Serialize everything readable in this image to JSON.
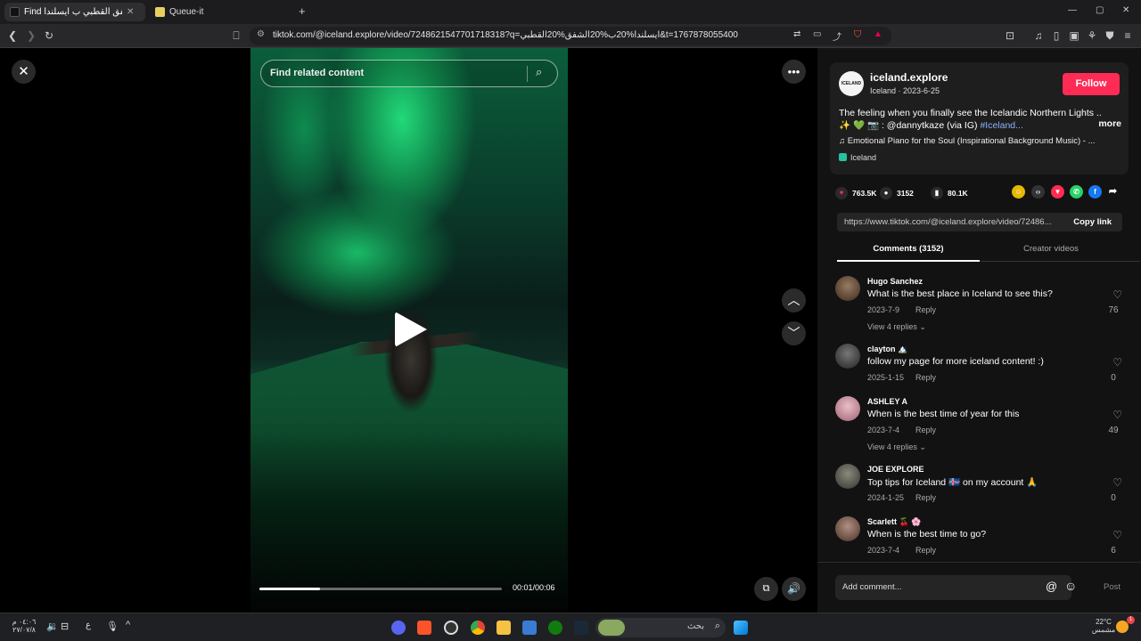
{
  "browser": {
    "tabs": [
      {
        "label": "Find الشفق القطبي ب ايسلندا"
      },
      {
        "label": "Queue-it"
      }
    ],
    "new_tab": "+",
    "url": "tiktok.com/@iceland.explore/video/7248621547701718318?q=ايسلندا%20ب%20الشفق%20القطبي&t=1767878055400",
    "window_controls": [
      "—",
      "▢",
      "✕"
    ]
  },
  "video": {
    "search_placeholder": "Find related content",
    "time": "00:01/00:06",
    "progress": 0.25
  },
  "author": {
    "avatar_text": "ICELAND",
    "username": "iceland.explore",
    "subtitle": "Iceland · 2023-6-25",
    "follow_label": "Follow",
    "description_line1": "The feeling when you finally see the Icelandic Northern Lights ..",
    "description_line2": "✨ 💚 📷 : @dannytkaze (via IG)",
    "hashtag": "#Iceland...",
    "more_label": "more",
    "music": "♫  Emotional Piano for the Soul (Inspirational Background Music) - ...",
    "location": "Iceland"
  },
  "stats": {
    "likes": "763.5K",
    "comments": "3152",
    "saves": "80.1K"
  },
  "link": {
    "url": "https://www.tiktok.com/@iceland.explore/video/72486...",
    "copy_label": "Copy link"
  },
  "panel_tabs": {
    "comments": "Comments (3152)",
    "creator": "Creator videos"
  },
  "comments": [
    {
      "name": "Hugo Sanchez",
      "text": "What is the best place in Iceland to see this?",
      "date": "2023-7-9",
      "reply": "Reply",
      "replies": "View 4 replies ⌄",
      "likes": "76"
    },
    {
      "name": "clayton 🏔️",
      "text": "follow my page for more iceland content! :)",
      "date": "2025-1-15",
      "reply": "Reply",
      "replies": "",
      "likes": "0"
    },
    {
      "name": "ASHLEY A",
      "text": "When is the best time of year for this",
      "date": "2023-7-4",
      "reply": "Reply",
      "replies": "View 4 replies ⌄",
      "likes": "49"
    },
    {
      "name": "JOE EXPLORE",
      "text": "Top tips for Iceland 🇮🇸 on my account 🙏",
      "date": "2024-1-25",
      "reply": "Reply",
      "replies": "",
      "likes": "0"
    },
    {
      "name": "Scarlett 🍒 🌸",
      "text": "When is the best time to go?",
      "date": "2023-7-4",
      "reply": "Reply",
      "replies": "",
      "likes": "6"
    }
  ],
  "add_comment": {
    "placeholder": "Add comment...",
    "post_label": "Post"
  },
  "taskbar": {
    "search_text": "بحث",
    "clock_time": "٠٤:٠٦ م",
    "clock_date": "٢٧/٠٧/٨",
    "weather_temp": "22°C",
    "weather_text": "مشمس",
    "lang": "ع"
  },
  "colors": {
    "accent": "#fe2c55",
    "panel_bg": "#121212",
    "aurora": "#22d97a"
  }
}
